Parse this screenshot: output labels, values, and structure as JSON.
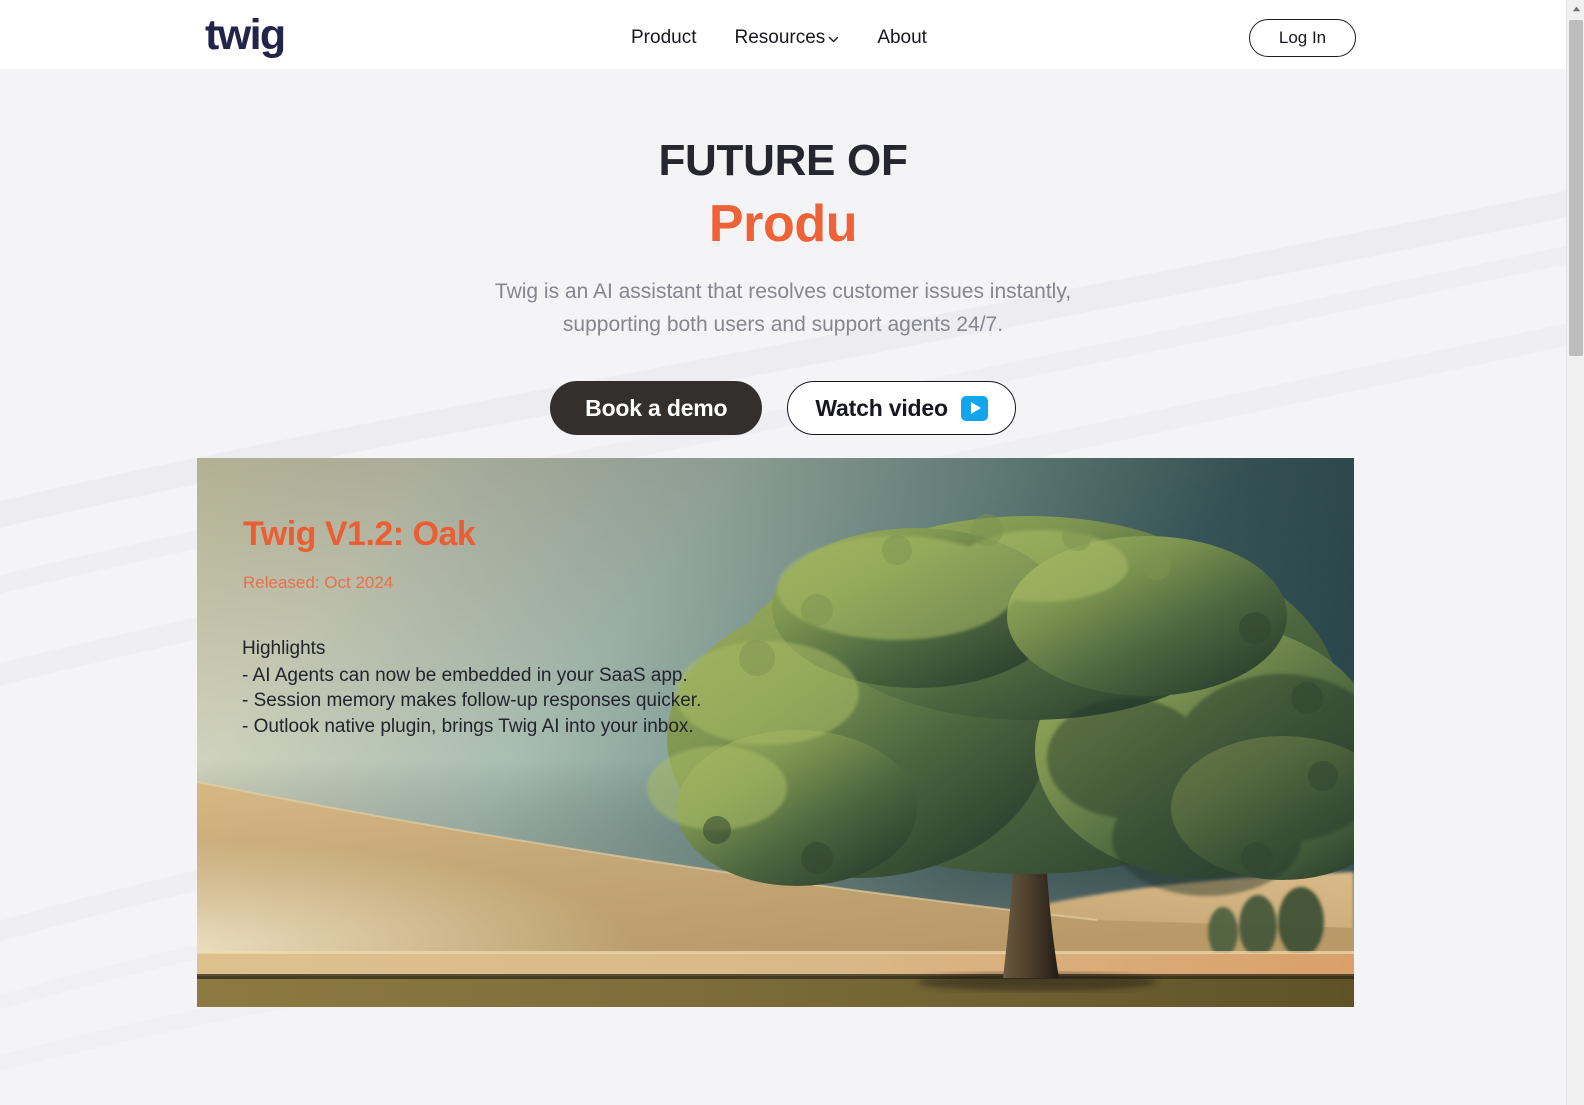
{
  "header": {
    "logo": "twig",
    "nav": [
      {
        "label": "Product",
        "has_caret": false,
        "icon": ""
      },
      {
        "label": "Resources",
        "has_caret": true,
        "icon": "chevron-down-icon"
      },
      {
        "label": "About",
        "has_caret": false,
        "icon": ""
      }
    ],
    "login_label": "Log In"
  },
  "hero": {
    "headline_static": "FUTURE OF",
    "headline_typed": "Produ",
    "subtitle_line1": "Twig is an AI assistant that resolves customer issues instantly,",
    "subtitle_line2": "supporting both users and support agents 24/7.",
    "primary_cta": "Book a demo",
    "secondary_cta": "Watch video",
    "secondary_cta_icon": "play-icon"
  },
  "card": {
    "title": "Twig V1.2: Oak",
    "released": "Released: Oct 2024",
    "highlights_heading": "Highlights",
    "highlights": [
      "- AI Agents can now be embedded in your SaaS app.",
      "- Session memory makes follow-up responses quicker.",
      "- Outlook native plugin, brings Twig AI into your inbox."
    ],
    "image_alt": "large oak tree on golden rolling hills at dusk"
  },
  "colors": {
    "accent_orange": "#ef6136",
    "headline_dark": "#25262e",
    "logo_navy": "#23244a",
    "button_dark": "#332f2d",
    "play_blue": "#12a5ee",
    "page_bg": "#f4f4f7",
    "header_bg": "#ffffff",
    "subtitle_gray": "#85868e"
  },
  "scrollbar": {
    "up_arrow_icon": "caret-up-icon",
    "thumb_label": "vertical-scroll-thumb"
  }
}
